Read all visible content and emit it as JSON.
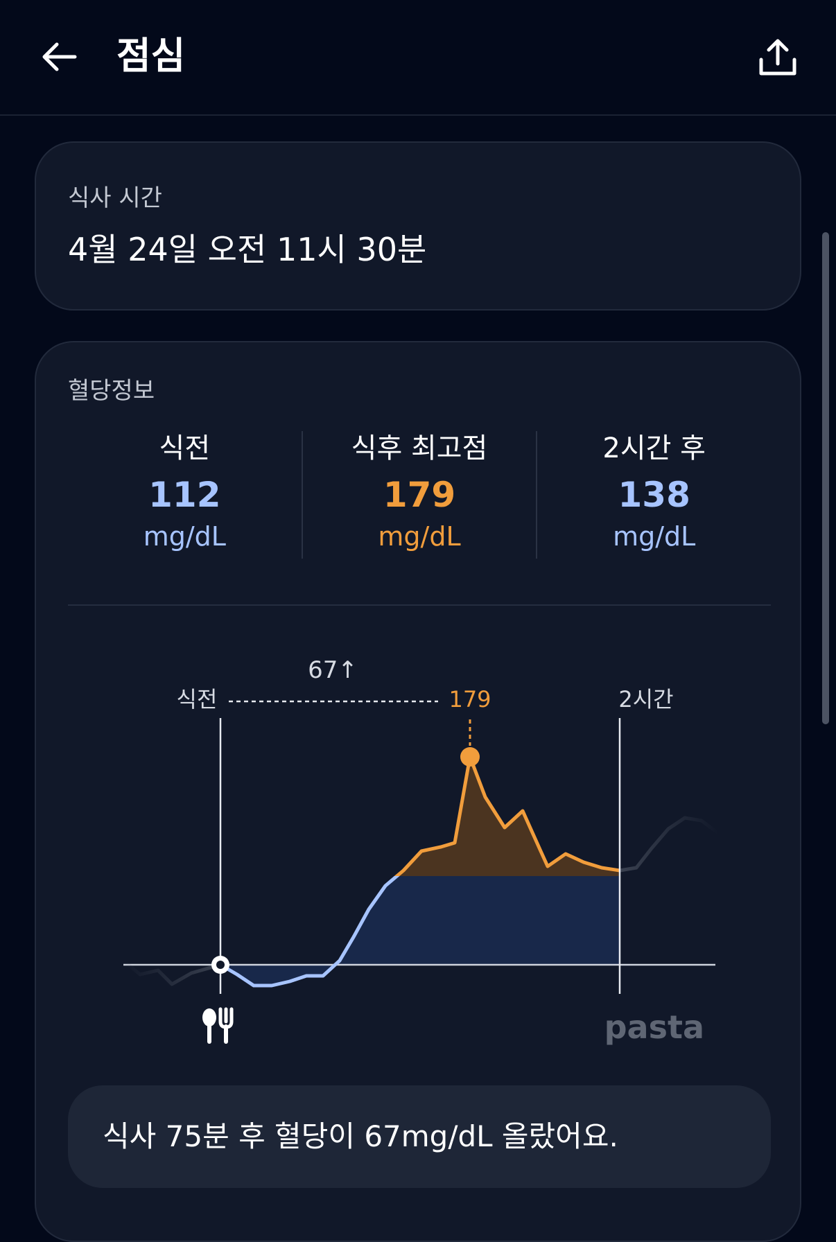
{
  "header": {
    "title": "점심",
    "back_icon": "arrow-left-icon",
    "share_icon": "share-upload-icon"
  },
  "meal_time": {
    "label": "식사 시간",
    "value": "4월 24일 오전 11시 30분"
  },
  "glucose": {
    "label": "혈당정보",
    "stats": [
      {
        "label": "식전",
        "value": "112",
        "unit": "mg/dL",
        "color": "#a7c4ff"
      },
      {
        "label": "식후 최고점",
        "value": "179",
        "unit": "mg/dL",
        "color": "#f19d3c"
      },
      {
        "label": "2시간 후",
        "value": "138",
        "unit": "mg/dL",
        "color": "#a7c4ff"
      }
    ]
  },
  "chart_data": {
    "type": "line",
    "unit": "mg/dL",
    "annotations": {
      "before_label": "식전",
      "rise_label": "67↑",
      "peak_label": "179",
      "after_label": "2시간",
      "watermark": "pasta",
      "meal_icon": "fork-knife-icon"
    },
    "before_value": 112,
    "peak_value": 179,
    "after_value": 138,
    "rise": 67,
    "minutes_to_peak": 75,
    "colors": {
      "line_main": "#a7c4ff",
      "line_above": "#f19d3c",
      "line_outside": "#3a4150",
      "fill_main": "#18284a",
      "fill_above": "#4b3420"
    }
  },
  "summary": {
    "text": "식사 75분 후 혈당이 67mg/dL 올랐어요."
  }
}
